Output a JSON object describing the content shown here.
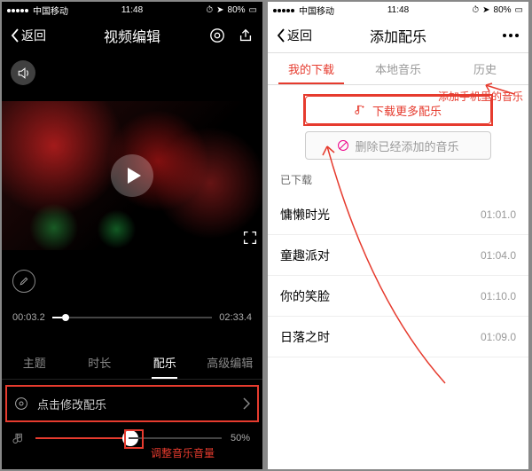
{
  "status": {
    "carrier": "中国移动",
    "time": "11:48",
    "battery": "80%"
  },
  "left": {
    "back": "返回",
    "title": "视频编辑",
    "timeStart": "00:03.2",
    "timeEnd": "02:33.4",
    "tabs": {
      "theme": "主题",
      "duration": "时长",
      "music": "配乐",
      "adv": "高级编辑"
    },
    "musicRow": "点击修改配乐",
    "volPct": "50%",
    "anno": "调整音乐音量"
  },
  "right": {
    "back": "返回",
    "title": "添加配乐",
    "tabs": {
      "dl": "我的下载",
      "local": "本地音乐",
      "history": "历史"
    },
    "btnDl": "下载更多配乐",
    "btnRm": "删除已经添加的音乐",
    "section": "已下载",
    "songs": [
      {
        "name": "慵懒时光",
        "t": "01:01.0"
      },
      {
        "name": "童趣派对",
        "t": "01:04.0"
      },
      {
        "name": "你的笑脸",
        "t": "01:10.0"
      },
      {
        "name": "日落之时",
        "t": "01:09.0"
      }
    ],
    "anno": "添加手机里的音乐"
  }
}
